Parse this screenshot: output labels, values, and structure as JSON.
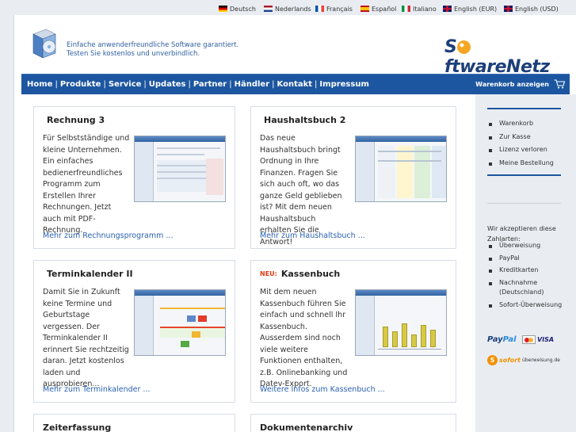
{
  "languages": [
    {
      "label": "Deutsch",
      "flag": "de-flag-icon"
    },
    {
      "label": "Nederlands",
      "flag": "nl-flag-icon"
    },
    {
      "label": "Français",
      "flag": "fr-flag-icon"
    },
    {
      "label": "Español",
      "flag": "es-flag-icon"
    },
    {
      "label": "Italiano",
      "flag": "it-flag-icon"
    },
    {
      "label": "English (EUR)",
      "flag": "gb-flag-icon"
    },
    {
      "label": "English (USD)",
      "flag": "gb-flag-icon"
    }
  ],
  "header": {
    "tagline_line1": "Einfache anwenderfreundliche Software garantiert.",
    "tagline_line2": "Testen Sie kostenlos und unverbindlich.",
    "brand_before": "S",
    "brand_after": "ftwareNetz",
    "logo_icon": "software-box-icon"
  },
  "nav": {
    "items": [
      "Home",
      "Produkte",
      "Service",
      "Updates",
      "Partner",
      "Händler",
      "Kontakt",
      "Impressum"
    ],
    "cart_label": "Warenkorb anzeigen",
    "cart_icon": "shopping-cart-icon"
  },
  "products": [
    {
      "title": "Rechnung 3",
      "neu": "",
      "description": "Für Selbstständige und kleine Unternehmen. Ein einfaches bedienerfreundliches Programm zum Erstellen Ihrer Rechnungen. Jetzt auch mit PDF-Rechnung.",
      "more": "Mehr zum Rechnungsprogramm ..."
    },
    {
      "title": "Haushaltsbuch 2",
      "neu": "",
      "description": "Das neue Haushaltsbuch bringt Ordnung in Ihre Finanzen. Fragen Sie sich auch oft, wo das ganze Geld geblieben ist? Mit dem neuen Haushaltsbuch erhalten Sie die Antwort!",
      "more": "Mehr zum Haushaltsbuch ..."
    },
    {
      "title": "Terminkalender II",
      "neu": "",
      "description": "Damit Sie in Zukunft keine Termine und Geburtstage vergessen. Der Terminkalender II erinnert Sie rechtzeitig daran. Jetzt kostenlos laden und ausprobieren...",
      "more": "Mehr zum Terminkalender ..."
    },
    {
      "title": "Kassenbuch",
      "neu": "NEU:",
      "description": "Mit dem neuen Kassenbuch führen Sie einfach und schnell Ihr Kassenbuch. Ausserdem sind noch viele weitere Funktionen enthalten, z.B. Onlinebanking und Datev-Export.",
      "more": "Weitere Infos zum Kassenbuch ..."
    },
    {
      "title": "Zeiterfassung",
      "neu": "",
      "description": "",
      "more": ""
    },
    {
      "title": "Dokumentenarchiv",
      "neu": "",
      "description": "",
      "more": ""
    }
  ],
  "sidebar": {
    "cart_links": [
      "Warenkorb",
      "Zur Kasse",
      "Lizenz verloren",
      "Meine Bestellung"
    ],
    "payment_note": "Wir akzeptieren diese Zahlarten:",
    "payment_methods": [
      "Überweisung",
      "PayPal",
      "Kreditkarten",
      "Nachnahme (Deutschland)",
      "Sofort-Überweisung"
    ],
    "paypal_pay": "Pay",
    "paypal_pal": "Pal",
    "visa": "VISA",
    "sofort_word": "sofort",
    "sofort_sub": "überweisung.de",
    "sofort_symbol": "S"
  },
  "colors": {
    "nav_blue": "#1d56a0",
    "link_blue": "#2b62b2",
    "neu_red": "#e23b12",
    "sidebar_bg": "#e9edf2"
  }
}
